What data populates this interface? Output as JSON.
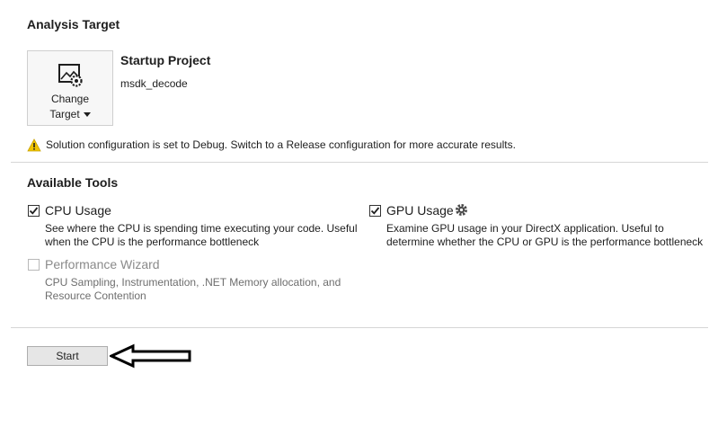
{
  "analysis_target": {
    "heading": "Analysis Target",
    "change_target_line1": "Change",
    "change_target_line2": "Target",
    "project_label": "Startup Project",
    "project_name": "msdk_decode",
    "warning": "Solution configuration is set to Debug. Switch to a Release configuration for more accurate results."
  },
  "available_tools": {
    "heading": "Available Tools",
    "tools": [
      {
        "name": "CPU Usage",
        "checked": true,
        "enabled": true,
        "description_line1": "See where the CPU is spending time executing your code. Useful",
        "description_line2": "when the CPU is the performance bottleneck"
      },
      {
        "name": "GPU Usage",
        "checked": true,
        "enabled": true,
        "has_settings": true,
        "icon": "gear-icon",
        "description_line1": "Examine GPU usage in your DirectX application. Useful to",
        "description_line2": "determine whether the CPU or GPU is the performance bottleneck"
      },
      {
        "name": "Performance Wizard",
        "checked": false,
        "enabled": false,
        "description_line1": "CPU Sampling, Instrumentation, .NET Memory allocation, and",
        "description_line2": "Resource Contention"
      }
    ]
  },
  "start_button": {
    "label": "Start"
  },
  "colors": {
    "warning_yellow": "#f0c400",
    "checkmark": "#1e1e1e"
  }
}
